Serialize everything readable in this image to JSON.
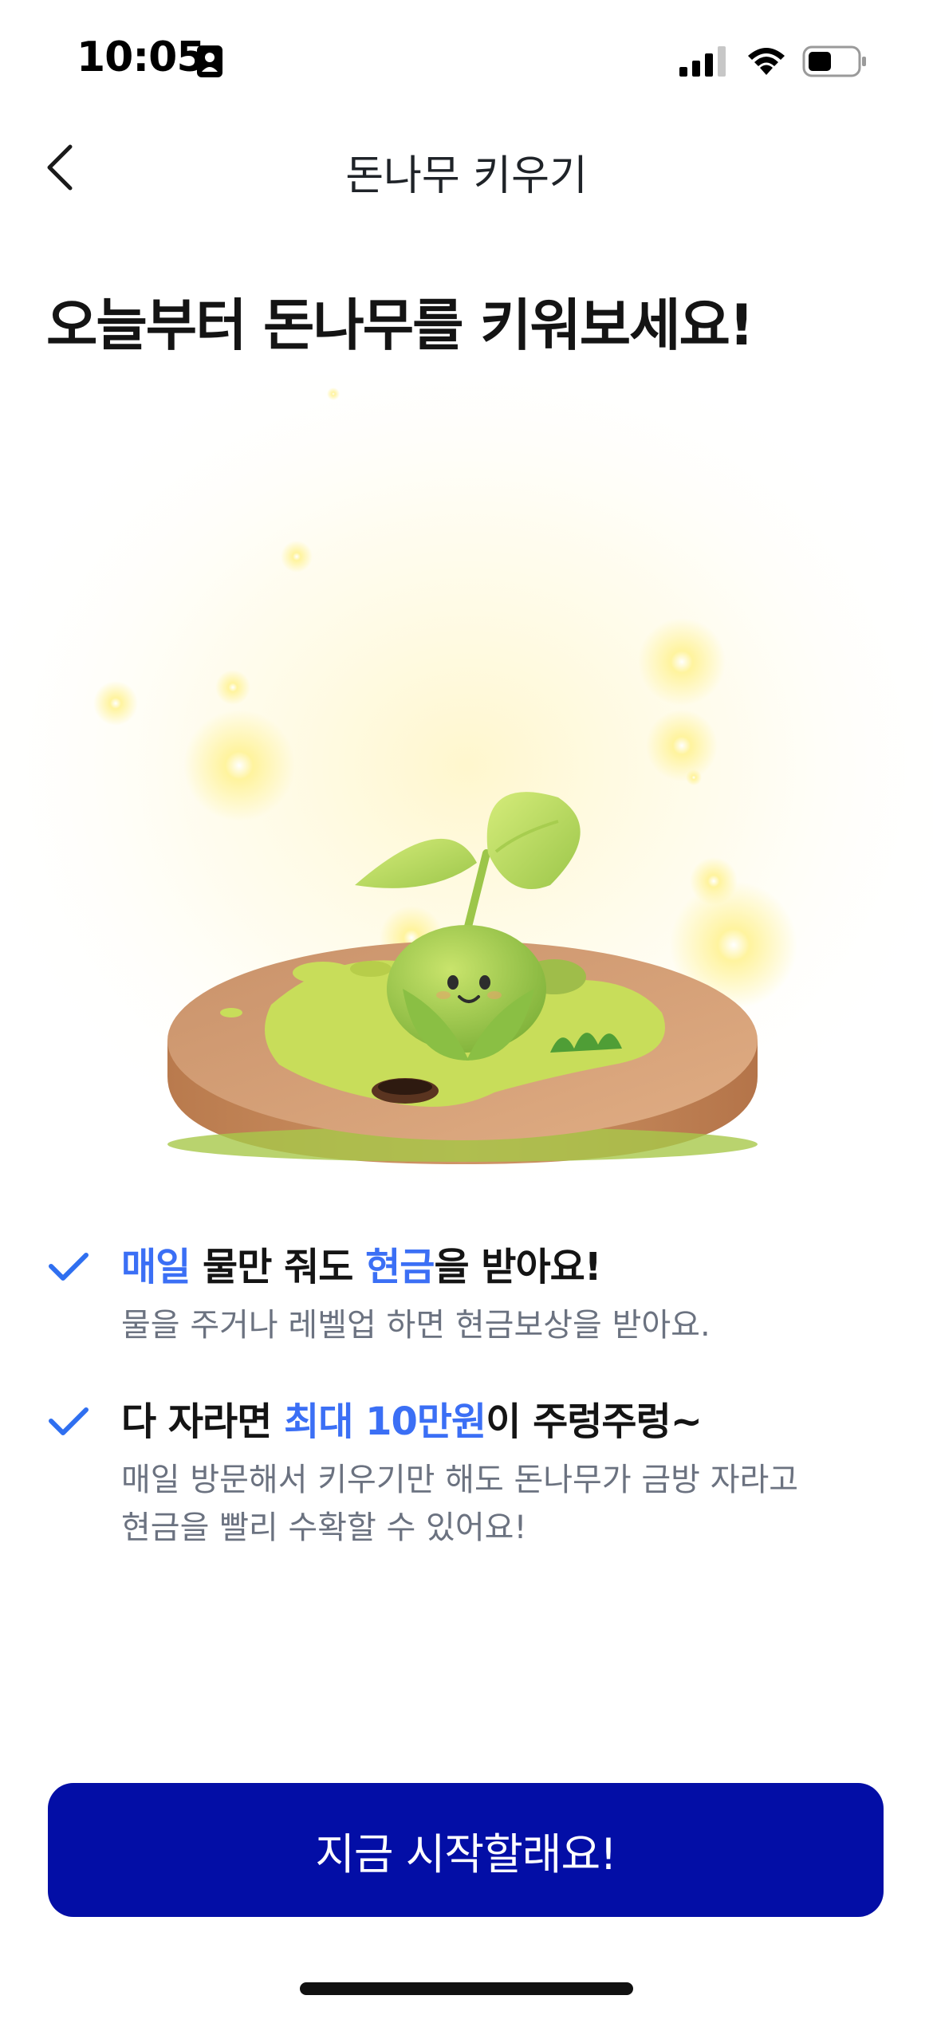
{
  "status_bar": {
    "time": "10:05"
  },
  "nav": {
    "title": "돈나무 키우기",
    "back_icon": "chevron-left-icon"
  },
  "headline": "오늘부터 돈나무를 키워보세요!",
  "colors": {
    "accent": "#3b6ff5",
    "cta_background": "#030ea6",
    "check": "#2f6ff0"
  },
  "benefits": [
    {
      "title_parts": [
        "매일",
        " 물만 줘도 ",
        "현금",
        "을 받아요!"
      ],
      "description_lines": [
        "물을 주거나 레벨업 하면 현금보상을 받아요."
      ]
    },
    {
      "title_parts": [
        "다 자라면 ",
        "최대 10만원",
        "이 주렁주렁~"
      ],
      "description_lines": [
        "매일 방문해서 키우기만 해도 돈나무가 금방 자라고",
        "현금을 빨리 수확할 수 있어요!"
      ]
    }
  ],
  "cta": {
    "label": "지금 시작할래요!"
  }
}
